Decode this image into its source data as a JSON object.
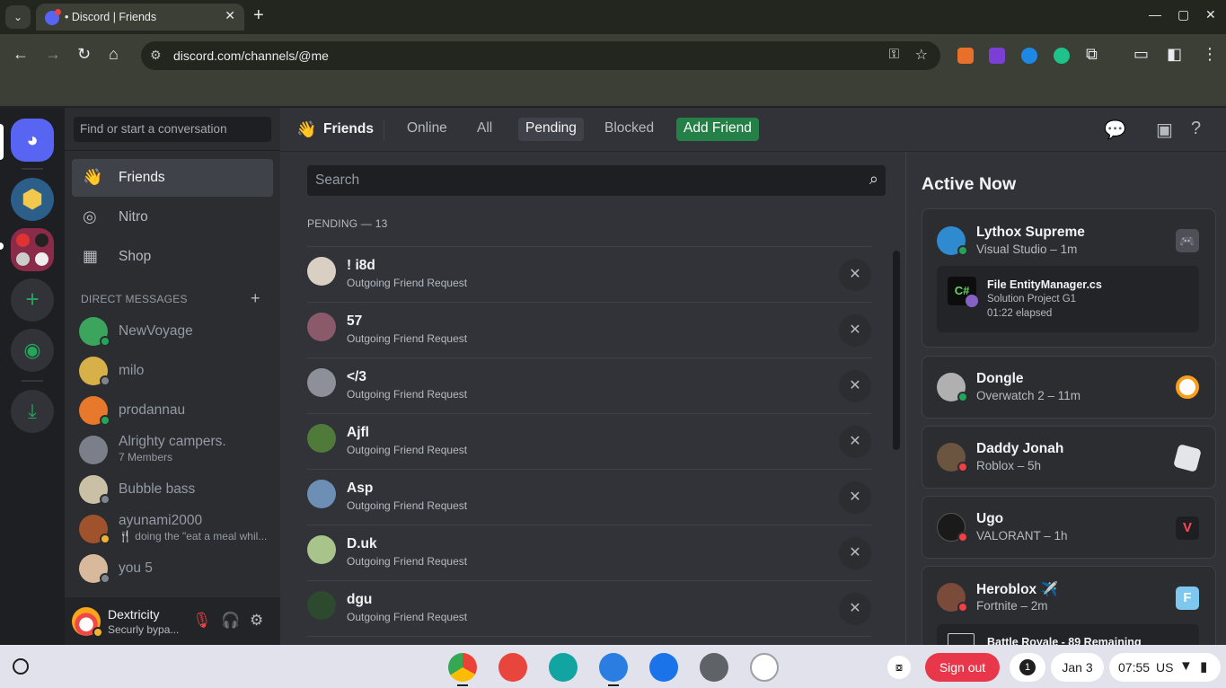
{
  "browser": {
    "tab_title": "• Discord | Friends",
    "tab_close": "✕",
    "new_tab": "+",
    "url": "discord.com/channels/@me",
    "win_min": "—",
    "win_max": "▢",
    "win_close": "✕"
  },
  "sidebar": {
    "finder_placeholder": "Find or start a conversation",
    "nav": [
      {
        "label": "Friends",
        "icon": "wave-person-icon"
      },
      {
        "label": "Nitro",
        "icon": "nitro-icon"
      },
      {
        "label": "Shop",
        "icon": "shop-icon"
      }
    ],
    "dm_header": "DIRECT MESSAGES",
    "dm_plus": "+",
    "dms": [
      {
        "name": "NewVoyage",
        "status": "online",
        "avatar_color": "#3ba55d"
      },
      {
        "name": "milo",
        "status": "offline",
        "avatar_color": "#d8b04a"
      },
      {
        "name": "prodannau",
        "status": "online",
        "avatar_color": "#e8782b"
      },
      {
        "name": "Alrighty campers.",
        "sub": "7 Members",
        "avatar_color": "#7a7f8a"
      },
      {
        "name": "Bubble bass",
        "status": "offline",
        "avatar_color": "#c9c0a6"
      },
      {
        "name": "ayunami2000",
        "sub": "🍴 doing the \"eat a meal whil...",
        "status": "idle",
        "avatar_color": "#a0522d"
      },
      {
        "name": "you 5",
        "status": "offline",
        "avatar_color": "#d9b99b"
      }
    ]
  },
  "user": {
    "name": "Dextricity",
    "status": "Securly bypa..."
  },
  "header": {
    "title": "Friends",
    "tabs": [
      "Online",
      "All",
      "Pending",
      "Blocked"
    ],
    "add_friend": "Add Friend"
  },
  "pending": {
    "search_placeholder": "Search",
    "heading": "PENDING — 13",
    "requests": [
      {
        "name": "! i8d",
        "sub": "Outgoing Friend Request",
        "avatar_color": "#d9cfc2"
      },
      {
        "name": "57",
        "sub": "Outgoing Friend Request",
        "avatar_color": "#8a5a6a"
      },
      {
        "name": "</3",
        "sub": "Outgoing Friend Request",
        "avatar_color": "#8d8f99"
      },
      {
        "name": "Ajfl",
        "sub": "Outgoing Friend Request",
        "avatar_color": "#4f7a3a"
      },
      {
        "name": "Asp",
        "sub": "Outgoing Friend Request",
        "avatar_color": "#6d8fb5"
      },
      {
        "name": "D.uk",
        "sub": "Outgoing Friend Request",
        "avatar_color": "#a9c48a"
      },
      {
        "name": "dgu",
        "sub": "Outgoing Friend Request",
        "avatar_color": "#2e4a2e"
      }
    ],
    "dismiss": "✕"
  },
  "active_now": {
    "title": "Active Now",
    "cards": [
      {
        "name": "Lythox Supreme",
        "activity": "Visual Studio – 1m",
        "status": "online",
        "avatar_color": "#2f8bd0",
        "game_icon_color": "#4e5058",
        "detail": {
          "title": "File EntityManager.cs",
          "line1": "Solution Project G1",
          "line2": "01:22 elapsed",
          "icon_text": "C#"
        }
      },
      {
        "name": "Dongle",
        "activity": "Overwatch 2 – 11m",
        "status": "online",
        "avatar_color": "#b0b0b0",
        "game_icon_color": "#f99e1a"
      },
      {
        "name": "Daddy Jonah",
        "activity": "Roblox – 5h",
        "status": "dnd",
        "avatar_color": "#6b5440",
        "game_icon_color": "#e3e5e8"
      },
      {
        "name": "Ugo",
        "activity": "VALORANT – 1h",
        "status": "dnd",
        "avatar_color": "#1a1a1a",
        "game_icon_color": "#ff4655"
      },
      {
        "name": "Heroblox ✈️",
        "activity": "Fortnite – 2m",
        "status": "dnd",
        "avatar_color": "#7a4a3a",
        "game_icon_color": "#7ec8f0",
        "detail": {
          "title": "Battle Royale - 89 Remaining"
        }
      }
    ]
  },
  "shelf": {
    "sign_out": "Sign out",
    "notif_count": "1",
    "date": "Jan 3",
    "time": "07:55",
    "locale": "US"
  },
  "colors": {
    "blurple": "#5865f2",
    "online": "#23a55a",
    "dnd": "#f23f43",
    "idle": "#f0b232",
    "signout": "#e8374a"
  }
}
